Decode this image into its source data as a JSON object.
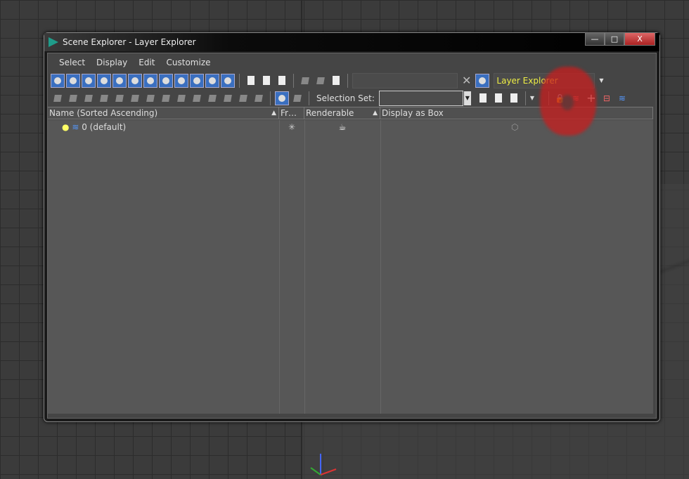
{
  "window": {
    "title": "Scene Explorer - Layer Explorer",
    "minimize": "—",
    "maximize": "□",
    "close": "X"
  },
  "menu": [
    "Select",
    "Display",
    "Edit",
    "Customize"
  ],
  "toolbar": {
    "search_value": "",
    "clear": "✕",
    "explorer_name": "Layer Explorer",
    "selection_set_label": "Selection Set:",
    "selection_set_value": ""
  },
  "columns": {
    "name": "Name (Sorted Ascending)",
    "frozen": "Fr…",
    "renderable": "Renderable",
    "display_as_box": "Display as Box",
    "sort_glyph": "▲"
  },
  "rows": [
    {
      "name": "0 (default)",
      "frozen_icon": "✳",
      "renderable_icon": "teapot-icon",
      "box_icon": "box-icon"
    }
  ],
  "annotation_color": "#c81e1e"
}
